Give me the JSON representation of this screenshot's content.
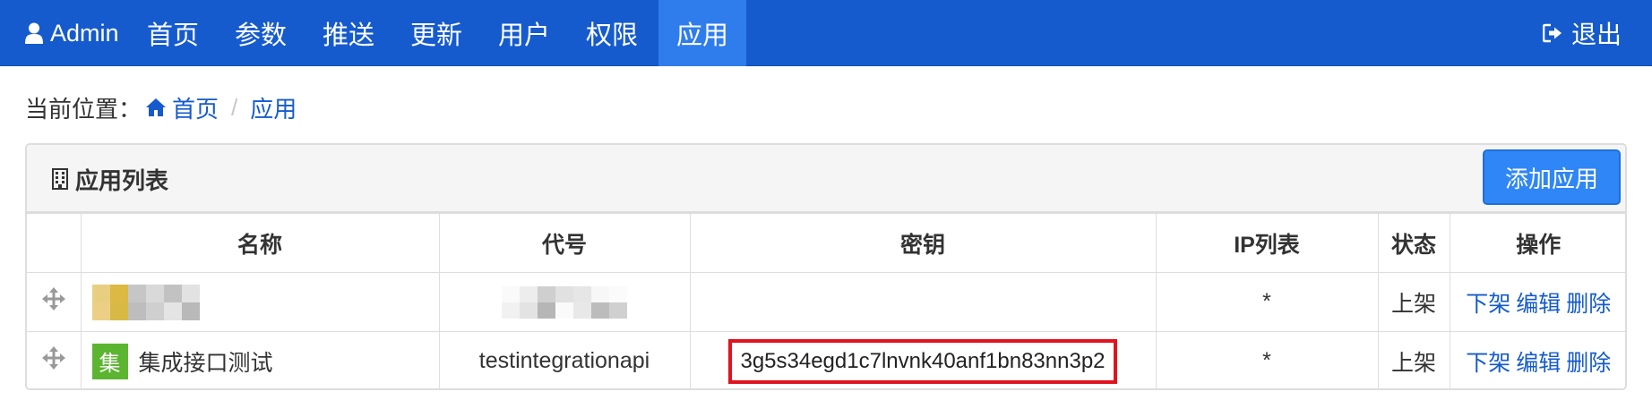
{
  "navbar": {
    "brand": "Admin",
    "items": [
      {
        "label": "首页"
      },
      {
        "label": "参数"
      },
      {
        "label": "推送"
      },
      {
        "label": "更新"
      },
      {
        "label": "用户"
      },
      {
        "label": "权限"
      },
      {
        "label": "应用",
        "active": true
      }
    ],
    "logout": "退出",
    "color": "#155bcd",
    "active_color": "#2f7ded"
  },
  "breadcrumb": {
    "prefix": "当前位置：",
    "home": "首页",
    "separator": "/",
    "current": "应用"
  },
  "panel": {
    "title": "应用列表",
    "add_button": "添加应用"
  },
  "table": {
    "headers": [
      "",
      "名称",
      "代号",
      "密钥",
      "IP列表",
      "状态",
      "操作"
    ],
    "rows": [
      {
        "name": "",
        "code": "",
        "secret": "",
        "ip": "*",
        "status": "上架",
        "actions": [
          "下架",
          "编辑",
          "删除"
        ]
      },
      {
        "badge": "集",
        "name": "集成接口测试",
        "code": "testintegrationapi",
        "secret": "3g5s34egd1c7lnvnk40anf1bn83nn3p2",
        "ip": "*",
        "status": "上架",
        "actions": [
          "下架",
          "编辑",
          "删除"
        ]
      }
    ]
  },
  "colors": {
    "primary_button": "#2f86f6",
    "badge_green": "#5cb531",
    "highlight_red": "#e0131e",
    "link": "#155bcd"
  }
}
